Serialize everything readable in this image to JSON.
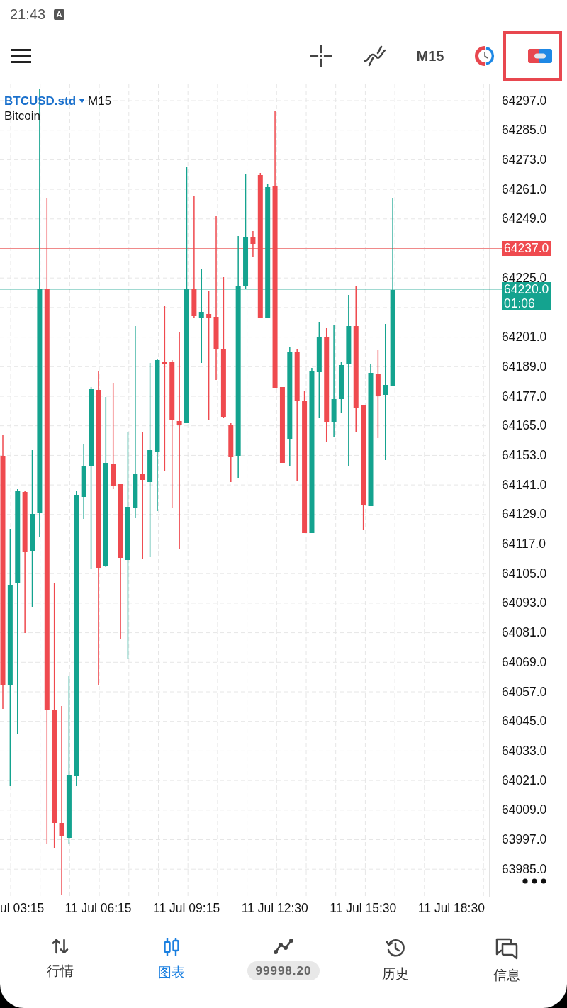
{
  "status_bar": {
    "time": "21:43",
    "notification_icon": "A"
  },
  "toolbar": {
    "items": [
      {
        "kind": "crosshair",
        "highlighted": false
      },
      {
        "kind": "indicators",
        "highlighted": false
      },
      {
        "kind": "timeframe",
        "label": "M15",
        "highlighted": false
      },
      {
        "kind": "chart_style",
        "highlighted": false
      },
      {
        "kind": "trade_panel",
        "highlighted": true
      }
    ]
  },
  "chart": {
    "symbol": "BTCUSD.std",
    "timeframe": "M15",
    "description": "Bitcoin",
    "price_axis": [
      {
        "kind": "tick",
        "label": "64297.0"
      },
      {
        "kind": "tick",
        "label": "64285.0"
      },
      {
        "kind": "tick",
        "label": "64273.0"
      },
      {
        "kind": "tick",
        "label": "64261.0"
      },
      {
        "kind": "tick",
        "label": "64249.0"
      },
      {
        "kind": "ask",
        "label": "64237.0"
      },
      {
        "kind": "tick",
        "label": "64225.0"
      },
      {
        "kind": "bid",
        "label": "64220.0",
        "countdown": "01:06"
      },
      {
        "kind": "tick",
        "label": "64201.0"
      },
      {
        "kind": "tick",
        "label": "64189.0"
      },
      {
        "kind": "tick",
        "label": "64177.0"
      },
      {
        "kind": "tick",
        "label": "64165.0"
      },
      {
        "kind": "tick",
        "label": "64153.0"
      },
      {
        "kind": "tick",
        "label": "64141.0"
      },
      {
        "kind": "tick",
        "label": "64129.0"
      },
      {
        "kind": "tick",
        "label": "64117.0"
      },
      {
        "kind": "tick",
        "label": "64105.0"
      },
      {
        "kind": "tick",
        "label": "64093.0"
      },
      {
        "kind": "tick",
        "label": "64081.0"
      },
      {
        "kind": "tick",
        "label": "64069.0"
      },
      {
        "kind": "tick",
        "label": "64057.0"
      },
      {
        "kind": "tick",
        "label": "64045.0"
      },
      {
        "kind": "tick",
        "label": "64033.0"
      },
      {
        "kind": "tick",
        "label": "64021.0"
      },
      {
        "kind": "tick",
        "label": "64009.0"
      },
      {
        "kind": "tick",
        "label": "63997.0"
      },
      {
        "kind": "tick",
        "label": "63985.0"
      }
    ],
    "time_axis": [
      "ul 03:15",
      "11 Jul 06:15",
      "11 Jul 09:15",
      "11 Jul 12:30",
      "11 Jul 15:30",
      "11 Jul 18:30"
    ]
  },
  "bottom_nav": [
    {
      "kind": "tab",
      "label": "行情",
      "selected": false
    },
    {
      "kind": "tab",
      "label": "图表",
      "selected": true
    },
    {
      "kind": "balance",
      "label": "99998.20",
      "selected": false
    },
    {
      "kind": "tab",
      "label": "历史",
      "selected": false
    },
    {
      "kind": "tab",
      "label": "信息",
      "selected": false
    }
  ]
}
